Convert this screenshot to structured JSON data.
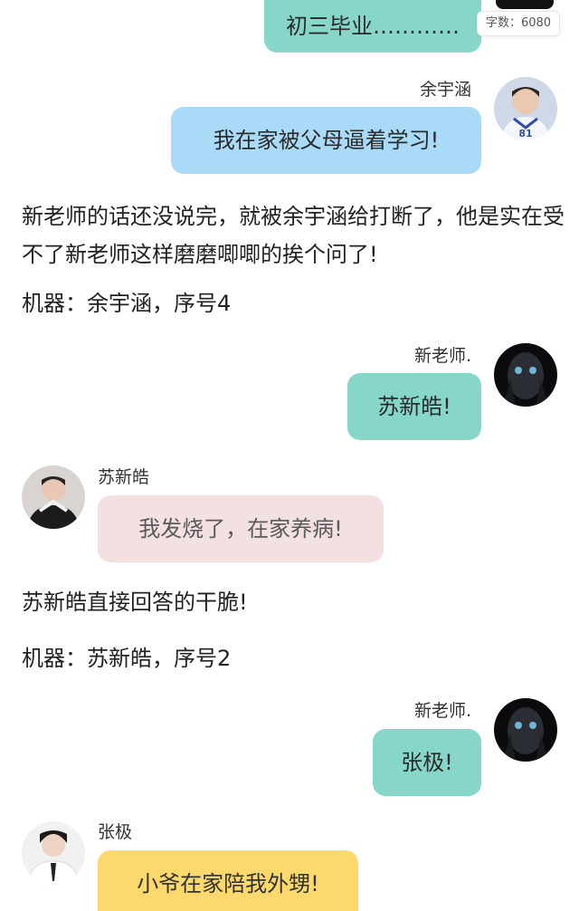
{
  "word_count": {
    "label": "字数：6080"
  },
  "messages": [
    {
      "speaker": "",
      "text": "初三毕业…………"
    },
    {
      "speaker": "余宇涵",
      "text": "我在家被父母逼着学习!"
    },
    {
      "speaker": "新老师.",
      "text": "苏新皓!"
    },
    {
      "speaker": "苏新皓",
      "text": "我发烧了，在家养病!"
    },
    {
      "speaker": "新老师.",
      "text": "张极!"
    },
    {
      "speaker": "张极",
      "text": "小爷在家陪我外甥!"
    }
  ],
  "narration": [
    "新老师的话还没说完，就被余宇涵给打断了，他是实在受不了新老师这样磨磨唧唧的挨个问了!",
    "机器：余宇涵，序号4",
    "苏新皓直接回答的干脆!",
    "机器：苏新皓，序号2"
  ],
  "avatar_icons": [
    "boy-jersey-81-avatar",
    "dark-mask-face-avatar",
    "boy-posing-avatar",
    "dark-mask-face-avatar",
    "boy-white-shirt-avatar"
  ],
  "colors": {
    "teal": "#86d7c9",
    "blue": "#a9dbf9",
    "pink": "#f3e0e1",
    "yellow": "#fcd86d"
  }
}
